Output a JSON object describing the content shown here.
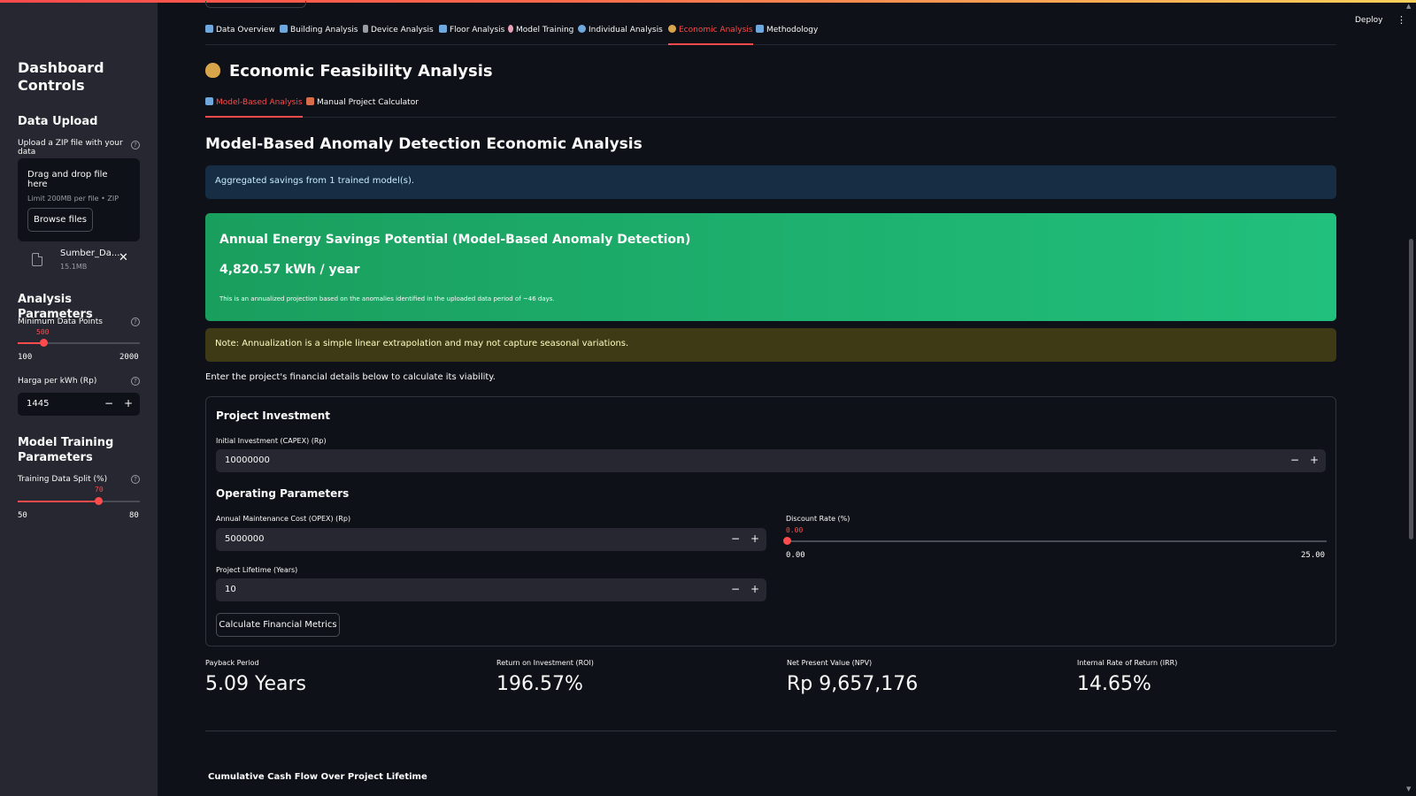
{
  "sidebar": {
    "title": "Dashboard Controls",
    "data_upload": {
      "heading": "Data Upload",
      "label": "Upload a ZIP file with your data",
      "dropzone_title": "Drag and drop file here",
      "dropzone_sub": "Limit 200MB per file • ZIP",
      "browse_label": "Browse files",
      "file_name": "Sumber_Da...",
      "file_size": "15.1MB"
    },
    "analysis": {
      "heading": "Analysis Parameters",
      "min_points_label": "Minimum Data Points",
      "min_points_value": "500",
      "min_points_min": "100",
      "min_points_max": "2000",
      "min_points_fraction": 0.21,
      "price_label": "Harga per kWh (Rp)",
      "price_value": "1445"
    },
    "training": {
      "heading": "Model Training Parameters",
      "split_label": "Training Data Split (%)",
      "split_value": "70",
      "split_min": "50",
      "split_max": "80",
      "split_fraction": 0.667
    }
  },
  "header": {
    "deploy_label": "Deploy",
    "menu_icon": "⋮"
  },
  "tabs": [
    {
      "label": "Data Overview",
      "icon": "chart-icon",
      "color": "#6fa8dc"
    },
    {
      "label": "Building Analysis",
      "icon": "building-icon",
      "color": "#6fa8dc"
    },
    {
      "label": "Device Analysis",
      "icon": "wrench-icon",
      "color": "#9a9ca4"
    },
    {
      "label": "Floor Analysis",
      "icon": "floor-icon",
      "color": "#6fa8dc"
    },
    {
      "label": "Model Training",
      "icon": "brain-icon",
      "color": "#e8a0b4"
    },
    {
      "label": "Individual Analysis",
      "icon": "magnifier-icon",
      "color": "#6fa8dc"
    },
    {
      "label": "Economic Analysis",
      "icon": "money-bag-icon",
      "color": "#d9a54a"
    },
    {
      "label": "Methodology",
      "icon": "book-icon",
      "color": "#6fa8dc"
    }
  ],
  "page_title": "Economic Feasibility Analysis",
  "subtabs": [
    {
      "label": "Model-Based Analysis",
      "icon": "chart-icon",
      "color": "#6fa8dc"
    },
    {
      "label": "Manual Project Calculator",
      "icon": "calculator-icon",
      "color": "#d96d4a"
    }
  ],
  "section_title": "Model-Based Anomaly Detection Economic Analysis",
  "info_text": "Aggregated savings from 1 trained model(s).",
  "savings_card": {
    "title": "Annual Energy Savings Potential (Model-Based Anomaly Detection)",
    "value": "4,820.57 kWh / year",
    "note": "This is an annualized projection based on the anomalies identified in the uploaded data period of ~46 days."
  },
  "warning_text": "Note: Annualization is a simple linear extrapolation and may not capture seasonal variations.",
  "intro_text": "Enter the project's financial details below to calculate its viability.",
  "form": {
    "investment_heading": "Project Investment",
    "capex_label": "Initial Investment (CAPEX) (Rp)",
    "capex_value": "10000000",
    "operating_heading": "Operating Parameters",
    "opex_label": "Annual Maintenance Cost (OPEX) (Rp)",
    "opex_value": "5000000",
    "discount_label": "Discount Rate (%)",
    "discount_value": "0.00",
    "discount_min": "0.00",
    "discount_max": "25.00",
    "discount_fraction": 0,
    "lifetime_label": "Project Lifetime (Years)",
    "lifetime_value": "10",
    "calculate_label": "Calculate Financial Metrics"
  },
  "metrics": [
    {
      "label": "Payback Period",
      "value": "5.09 Years"
    },
    {
      "label": "Return on Investment (ROI)",
      "value": "196.57%"
    },
    {
      "label": "Net Present Value (NPV)",
      "value": "Rp 9,657,176"
    },
    {
      "label": "Internal Rate of Return (IRR)",
      "value": "14.65%"
    }
  ],
  "chart_title": "Cumulative Cash Flow Over Project Lifetime",
  "colors": {
    "accent": "#ff4b4b",
    "success": "#21c07c",
    "info_bg": "#172d43",
    "warning_bg": "#3e3a16"
  }
}
